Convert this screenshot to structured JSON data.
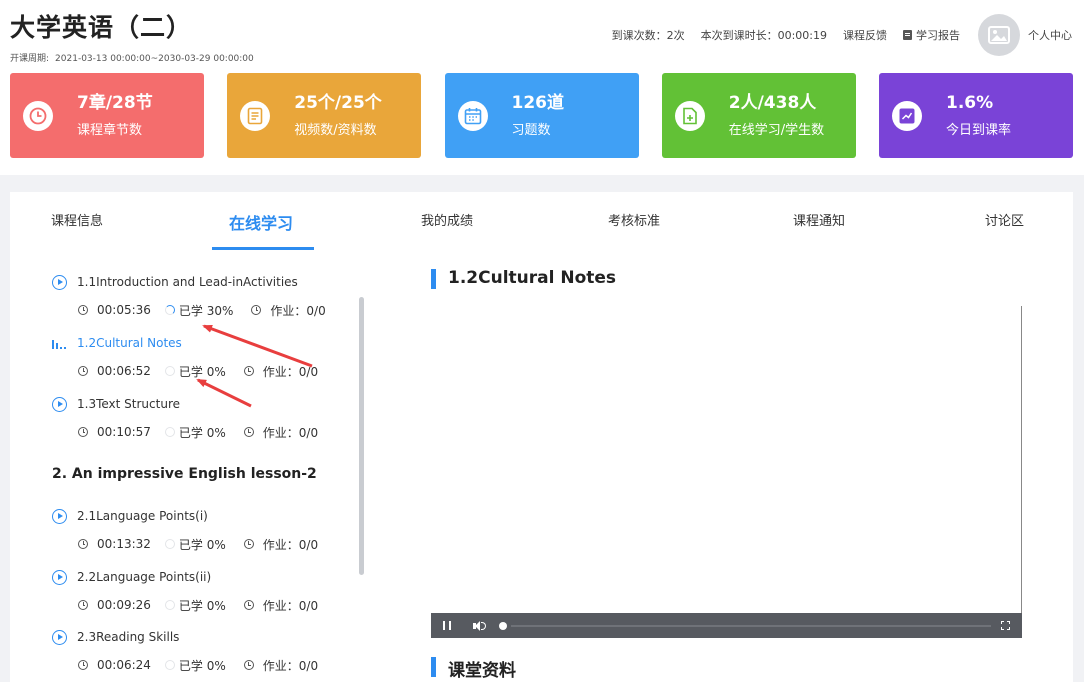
{
  "header": {
    "course_title": "大学英语（二）",
    "period_label": "开课周期:",
    "period_value": "2021-03-13 00:00:00~2030-03-29 00:00:00",
    "attendance": "到课次数：2次",
    "duration": "本次到课时长：00:00:19",
    "feedback": "课程反馈",
    "report": "学习报告",
    "user_center": "个人中心"
  },
  "stats": [
    {
      "value": "7章/28节",
      "label": "课程章节数",
      "color": "#f46d6d",
      "icon": "clock-icon"
    },
    {
      "value": "25个/25个",
      "label": "视频数/资料数",
      "color": "#e9a63a",
      "icon": "document-icon"
    },
    {
      "value": "126道",
      "label": "习题数",
      "color": "#40a0f5",
      "icon": "calendar-icon"
    },
    {
      "value": "2人/438人",
      "label": "在线学习/学生数",
      "color": "#62c136",
      "icon": "file-add-icon"
    },
    {
      "value": "1.6%",
      "label": "今日到课率",
      "color": "#7a43d7",
      "icon": "chart-icon"
    }
  ],
  "tabs": [
    "课程信息",
    "在线学习",
    "我的成绩",
    "考核标准",
    "课程通知",
    "讨论区"
  ],
  "lessons": [
    {
      "title": "1.1Introduction and Lead-inActivities",
      "time": "00:05:36",
      "progress": "已学 30%",
      "homework": "作业：0/0",
      "active": false
    },
    {
      "title": "1.2Cultural Notes",
      "time": "00:06:52",
      "progress": "已学 0%",
      "homework": "作业：0/0",
      "active": true
    },
    {
      "title": "1.3Text Structure",
      "time": "00:10:57",
      "progress": "已学 0%",
      "homework": "作业：0/0",
      "active": false
    },
    {
      "title": "2.1Language Points(i)",
      "time": "00:13:32",
      "progress": "已学 0%",
      "homework": "作业：0/0",
      "active": false
    },
    {
      "title": "2.2Language Points(ii)",
      "time": "00:09:26",
      "progress": "已学 0%",
      "homework": "作业：0/0",
      "active": false
    },
    {
      "title": "2.3Reading Skills",
      "time": "00:06:24",
      "progress": "已学 0%",
      "homework": "作业：0/0",
      "active": false
    }
  ],
  "chapter2": "2. An impressive English lesson-2",
  "video_title": "1.2Cultural Notes",
  "materials_title": "课堂资料",
  "colors": {
    "accent": "#2d8cf0",
    "annotation_arrow": "#e83e3e"
  }
}
